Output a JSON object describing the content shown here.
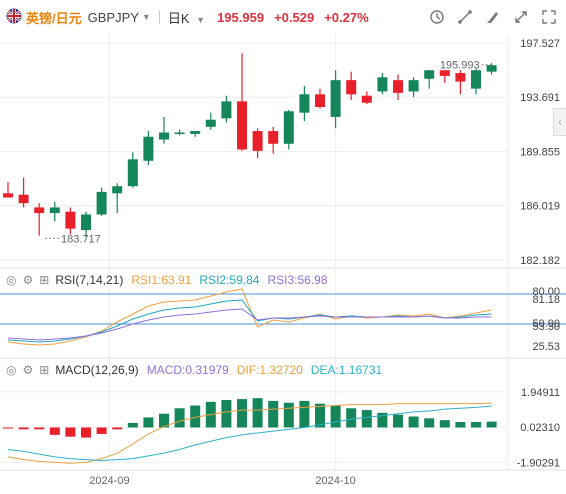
{
  "header": {
    "name": "英镑/日元",
    "code": "GBPJPY",
    "period": "日K",
    "price": "195.959",
    "change": "+0.529",
    "change_pct": "+0.27%",
    "flag_icon": "uk-flag-icon",
    "tools": [
      "alert-icon",
      "draw-icon",
      "brush-icon",
      "expand-icon",
      "fullscreen-icon"
    ]
  },
  "colors": {
    "up": "#15865a",
    "down": "#e8202a",
    "grid": "#eeeeee",
    "rsi1": "#f0a040",
    "rsi2": "#22a8c0",
    "rsi3": "#9070d8",
    "macd_line": "#e8a040",
    "dea_line": "#30b0c8"
  },
  "rsi_label": {
    "title": "RSI(7,14,21)",
    "rsi1": "RSI1:63.91",
    "rsi2": "RSI2:59.84",
    "rsi3": "RSI3:56.98"
  },
  "macd_label": {
    "title": "MACD(12,26,9)",
    "macd": "MACD:0.31979",
    "dif": "DIF:1.32720",
    "dea": "DEA:1.16731"
  },
  "chart_data": [
    {
      "type": "candlestick",
      "title": "GBPJPY 日K",
      "y_ticks": [
        "197.527",
        "193.691",
        "189.855",
        "186.019",
        "182.182"
      ],
      "ylim": [
        182.182,
        197.527
      ],
      "x_ticks": [
        {
          "label": "2024-09",
          "index": 6.5
        },
        {
          "label": "2024-10",
          "index": 21
        }
      ],
      "annotations": [
        {
          "text": "195.993",
          "index": 31,
          "value": 195.993
        },
        {
          "text": "183.717",
          "index": 2.5,
          "value": 183.717
        }
      ],
      "candles": [
        {
          "o": 186.9,
          "h": 187.7,
          "l": 186.6,
          "c": 186.6
        },
        {
          "o": 186.8,
          "h": 188.0,
          "l": 185.9,
          "c": 186.2
        },
        {
          "o": 185.9,
          "h": 186.2,
          "l": 183.9,
          "c": 185.5
        },
        {
          "o": 185.5,
          "h": 186.3,
          "l": 184.9,
          "c": 185.9
        },
        {
          "o": 185.6,
          "h": 185.9,
          "l": 184.0,
          "c": 184.4
        },
        {
          "o": 184.3,
          "h": 185.6,
          "l": 183.8,
          "c": 185.4
        },
        {
          "o": 185.4,
          "h": 187.3,
          "l": 185.3,
          "c": 187.0
        },
        {
          "o": 186.9,
          "h": 187.6,
          "l": 185.5,
          "c": 187.4
        },
        {
          "o": 187.4,
          "h": 189.8,
          "l": 187.3,
          "c": 189.3
        },
        {
          "o": 189.2,
          "h": 191.3,
          "l": 188.9,
          "c": 190.9
        },
        {
          "o": 190.7,
          "h": 192.3,
          "l": 190.4,
          "c": 191.2
        },
        {
          "o": 191.2,
          "h": 191.4,
          "l": 191.0,
          "c": 191.2
        },
        {
          "o": 191.1,
          "h": 191.3,
          "l": 190.9,
          "c": 191.3
        },
        {
          "o": 191.6,
          "h": 192.6,
          "l": 191.4,
          "c": 192.1
        },
        {
          "o": 192.2,
          "h": 193.8,
          "l": 191.9,
          "c": 193.4
        },
        {
          "o": 193.4,
          "h": 196.8,
          "l": 189.9,
          "c": 190.0
        },
        {
          "o": 191.3,
          "h": 191.5,
          "l": 189.4,
          "c": 189.9
        },
        {
          "o": 191.3,
          "h": 191.6,
          "l": 189.7,
          "c": 190.4
        },
        {
          "o": 190.4,
          "h": 192.8,
          "l": 190.0,
          "c": 192.7
        },
        {
          "o": 192.6,
          "h": 194.5,
          "l": 192.0,
          "c": 193.9
        },
        {
          "o": 193.9,
          "h": 194.3,
          "l": 192.9,
          "c": 193.0
        },
        {
          "o": 192.3,
          "h": 195.6,
          "l": 191.5,
          "c": 194.9
        },
        {
          "o": 194.9,
          "h": 195.5,
          "l": 193.5,
          "c": 193.9
        },
        {
          "o": 193.8,
          "h": 194.1,
          "l": 193.2,
          "c": 193.3
        },
        {
          "o": 194.1,
          "h": 195.4,
          "l": 193.9,
          "c": 195.1
        },
        {
          "o": 194.9,
          "h": 195.3,
          "l": 193.5,
          "c": 194.0
        },
        {
          "o": 194.1,
          "h": 195.1,
          "l": 193.7,
          "c": 194.9
        },
        {
          "o": 195.0,
          "h": 195.6,
          "l": 194.3,
          "c": 195.6
        },
        {
          "o": 195.6,
          "h": 195.6,
          "l": 194.7,
          "c": 195.2
        },
        {
          "o": 195.4,
          "h": 195.6,
          "l": 193.9,
          "c": 194.8
        },
        {
          "o": 194.3,
          "h": 195.7,
          "l": 193.9,
          "c": 195.6
        },
        {
          "o": 195.5,
          "h": 196.1,
          "l": 195.3,
          "c": 195.959
        }
      ]
    },
    {
      "type": "line",
      "title": "RSI(7,14,21)",
      "y_ticks": [
        "80.00",
        "81.18",
        "50.00",
        "53.30",
        "25.53"
      ],
      "ylim": [
        20,
        86
      ],
      "reference_lines": [
        80,
        50
      ],
      "series": [
        {
          "name": "RSI1",
          "values": [
            32,
            30,
            29,
            30,
            33,
            37,
            43,
            52,
            60,
            68,
            72,
            73,
            74,
            78,
            82,
            85,
            47,
            54,
            52,
            56,
            60,
            55,
            58,
            56,
            57,
            59,
            58,
            60,
            56,
            58,
            61,
            64
          ]
        },
        {
          "name": "RSI2",
          "values": [
            34,
            33,
            32,
            33,
            35,
            38,
            42,
            48,
            55,
            60,
            64,
            66,
            67,
            70,
            73,
            74,
            53,
            56,
            55,
            57,
            59,
            57,
            58,
            57,
            57,
            58,
            57,
            58,
            56,
            57,
            59,
            60
          ]
        },
        {
          "name": "RSI3",
          "values": [
            36,
            35,
            34,
            35,
            36,
            38,
            41,
            45,
            50,
            54,
            57,
            59,
            60,
            62,
            64,
            65,
            54,
            56,
            56,
            57,
            58,
            57,
            57,
            57,
            57,
            57,
            57,
            58,
            56,
            56,
            57,
            57
          ]
        }
      ]
    },
    {
      "type": "bar",
      "title": "MACD(12,26,9)",
      "y_ticks": [
        "1.94911",
        "0.02310",
        "-1.90291"
      ],
      "ylim": [
        -2.1,
        2.7
      ],
      "series": [
        {
          "name": "MACD",
          "values": [
            -0.05,
            -0.1,
            -0.1,
            -0.4,
            -0.5,
            -0.55,
            -0.35,
            -0.1,
            0.25,
            0.55,
            0.75,
            1.05,
            1.2,
            1.4,
            1.5,
            1.55,
            1.6,
            1.45,
            1.35,
            1.45,
            1.3,
            1.2,
            1.05,
            0.95,
            0.8,
            0.7,
            0.6,
            0.5,
            0.4,
            0.3,
            0.3,
            0.32
          ]
        },
        {
          "name": "DIF",
          "values": [
            -1.6,
            -1.75,
            -1.85,
            -1.9,
            -1.95,
            -1.9,
            -1.7,
            -1.4,
            -0.9,
            -0.35,
            0.05,
            0.35,
            0.55,
            0.7,
            0.85,
            0.95,
            0.95,
            1.0,
            1.05,
            1.1,
            1.15,
            1.2,
            1.25,
            1.25,
            1.25,
            1.3,
            1.3,
            1.3,
            1.3,
            1.3,
            1.3,
            1.33
          ]
        },
        {
          "name": "DEA",
          "values": [
            -1.2,
            -1.3,
            -1.45,
            -1.6,
            -1.7,
            -1.75,
            -1.8,
            -1.75,
            -1.7,
            -1.55,
            -1.4,
            -1.2,
            -0.95,
            -0.75,
            -0.55,
            -0.4,
            -0.3,
            -0.2,
            -0.1,
            0.0,
            0.15,
            0.3,
            0.45,
            0.55,
            0.65,
            0.75,
            0.85,
            0.9,
            1.0,
            1.05,
            1.1,
            1.17
          ]
        }
      ]
    }
  ]
}
